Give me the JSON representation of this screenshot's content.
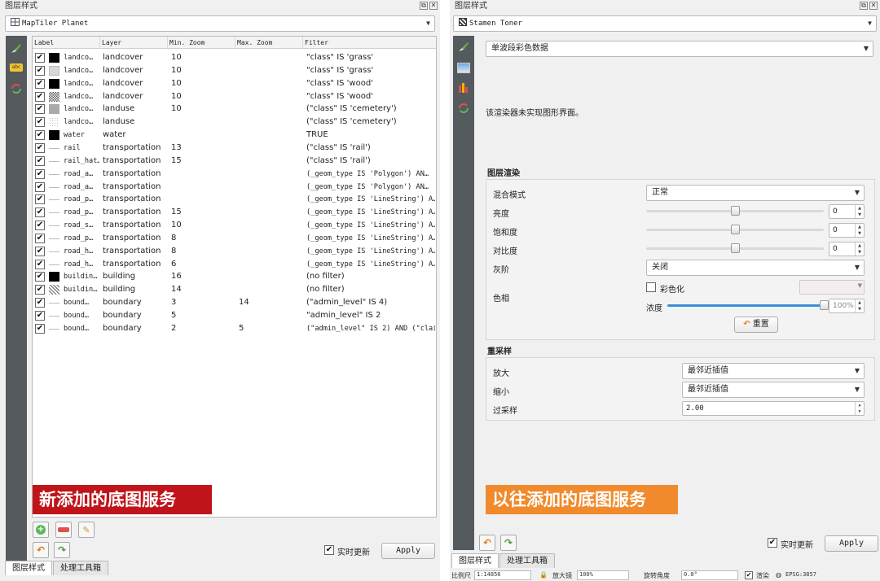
{
  "left": {
    "title": "图层样式",
    "layer_combo": "MapTiler Planet",
    "columns": [
      "Label",
      "Layer",
      "Min. Zoom",
      "Max. Zoom",
      "Filter"
    ],
    "rows": [
      {
        "label": "landco…",
        "layer": "landcover",
        "min": "10",
        "max": "",
        "filter": "\"class\" IS 'grass'",
        "sym": "solid-black"
      },
      {
        "label": "landco…",
        "layer": "landcover",
        "min": "10",
        "max": "",
        "filter": "\"class\" IS 'grass'",
        "sym": "solid-lightgray"
      },
      {
        "label": "landco…",
        "layer": "landcover",
        "min": "10",
        "max": "",
        "filter": "\"class\" IS 'wood'",
        "sym": "solid-black"
      },
      {
        "label": "landco…",
        "layer": "landcover",
        "min": "10",
        "max": "",
        "filter": "\"class\" IS 'wood'",
        "sym": "checker"
      },
      {
        "label": "landco…",
        "layer": "landuse",
        "min": "10",
        "max": "",
        "filter": "(\"class\" IS 'cemetery')",
        "sym": "solid-gray"
      },
      {
        "label": "landco…",
        "layer": "landuse",
        "min": "",
        "max": "",
        "filter": "(\"class\" IS 'cemetery')",
        "sym": "dotted"
      },
      {
        "label": "water",
        "layer": "water",
        "min": "",
        "max": "",
        "filter": "TRUE",
        "sym": "solid-black"
      },
      {
        "label": "rail",
        "layer": "transportation",
        "min": "13",
        "max": "",
        "filter": "(\"class\" IS 'rail')",
        "sym": "line"
      },
      {
        "label": "rail_hat…",
        "layer": "transportation",
        "min": "15",
        "max": "",
        "filter": "(\"class\" IS 'rail')",
        "sym": "line"
      },
      {
        "label": "road_a…",
        "layer": "transportation",
        "min": "",
        "max": "",
        "filter": "(_geom_type IS 'Polygon') AN…",
        "sym": "line",
        "mono": true
      },
      {
        "label": "road_a…",
        "layer": "transportation",
        "min": "",
        "max": "",
        "filter": "(_geom_type IS 'Polygon') AN…",
        "sym": "line",
        "mono": true
      },
      {
        "label": "road_p…",
        "layer": "transportation",
        "min": "",
        "max": "",
        "filter": "(_geom_type IS 'LineString') A…",
        "sym": "line",
        "mono": true
      },
      {
        "label": "road_p…",
        "layer": "transportation",
        "min": "15",
        "max": "",
        "filter": "(_geom_type IS 'LineString') A…",
        "sym": "line",
        "mono": true
      },
      {
        "label": "road_s…",
        "layer": "transportation",
        "min": "10",
        "max": "",
        "filter": "(_geom_type IS 'LineString') A…",
        "sym": "line",
        "mono": true
      },
      {
        "label": "road_p…",
        "layer": "transportation",
        "min": "8",
        "max": "",
        "filter": "(_geom_type IS 'LineString') A…",
        "sym": "line",
        "mono": true
      },
      {
        "label": "road_h…",
        "layer": "transportation",
        "min": "8",
        "max": "",
        "filter": "(_geom_type IS 'LineString') A…",
        "sym": "line",
        "mono": true
      },
      {
        "label": "road_h…",
        "layer": "transportation",
        "min": "6",
        "max": "",
        "filter": "(_geom_type IS 'LineString') A…",
        "sym": "line",
        "mono": true
      },
      {
        "label": "buildin…",
        "layer": "building",
        "min": "16",
        "max": "",
        "filter": "(no filter)",
        "sym": "solid-black"
      },
      {
        "label": "buildin…",
        "layer": "building",
        "min": "14",
        "max": "",
        "filter": "(no filter)",
        "sym": "hatch"
      },
      {
        "label": "bound…",
        "layer": "boundary",
        "min": "3",
        "max": "14",
        "filter": "(\"admin_level\" IS 4)",
        "sym": "line"
      },
      {
        "label": "bound…",
        "layer": "boundary",
        "min": "5",
        "max": "",
        "filter": "\"admin_level\" IS 2",
        "sym": "line"
      },
      {
        "label": "bound…",
        "layer": "boundary",
        "min": "2",
        "max": "5",
        "filter": "(\"admin_level\" IS 2) AND (\"clai…",
        "sym": "line",
        "mono": true
      }
    ],
    "banner": "新添加的底图服务",
    "realtime": "实时更新",
    "apply": "Apply",
    "tabs": [
      "图层样式",
      "处理工具箱"
    ]
  },
  "right": {
    "title": "图层样式",
    "layer_combo": "Stamen Toner",
    "renderer_combo": "单波段彩色数据",
    "no_gui_msg": "该渲染器未实现图形界面。",
    "render_section": "图层渲染",
    "blend_label": "混合模式",
    "blend_value": "正常",
    "brightness_label": "亮度",
    "brightness_value": "0",
    "saturation_label": "饱和度",
    "saturation_value": "0",
    "contrast_label": "对比度",
    "contrast_value": "0",
    "grayscale_label": "灰阶",
    "grayscale_value": "关闭",
    "hue_label": "色相",
    "colorize_label": "彩色化",
    "strength_label": "浓度",
    "strength_value": "100%",
    "reset_label": "重置",
    "resample_section": "重采样",
    "zoomin_label": "放大",
    "zoomin_value": "最邻近插值",
    "zoomout_label": "缩小",
    "zoomout_value": "最邻近插值",
    "oversample_label": "过采样",
    "oversample_value": "2.00",
    "banner": "以往添加的底图服务",
    "realtime": "实时更新",
    "apply": "Apply",
    "tabs": [
      "图层样式",
      "处理工具箱"
    ]
  },
  "statusbar": {
    "scale_label": "比例尺",
    "scale_value": "1:14856",
    "magnifier_label": "放大镜",
    "magnifier_value": "100%",
    "rotation_label": "旋转角度",
    "rotation_value": "0.0°",
    "render_label": "渲染",
    "crs": "EPSG:3857"
  },
  "colors": {
    "accent_red": "#c0141a",
    "accent_orange": "#f08a2c",
    "slider_blue": "#3b8fd8",
    "sidebar": "#555a5e"
  }
}
